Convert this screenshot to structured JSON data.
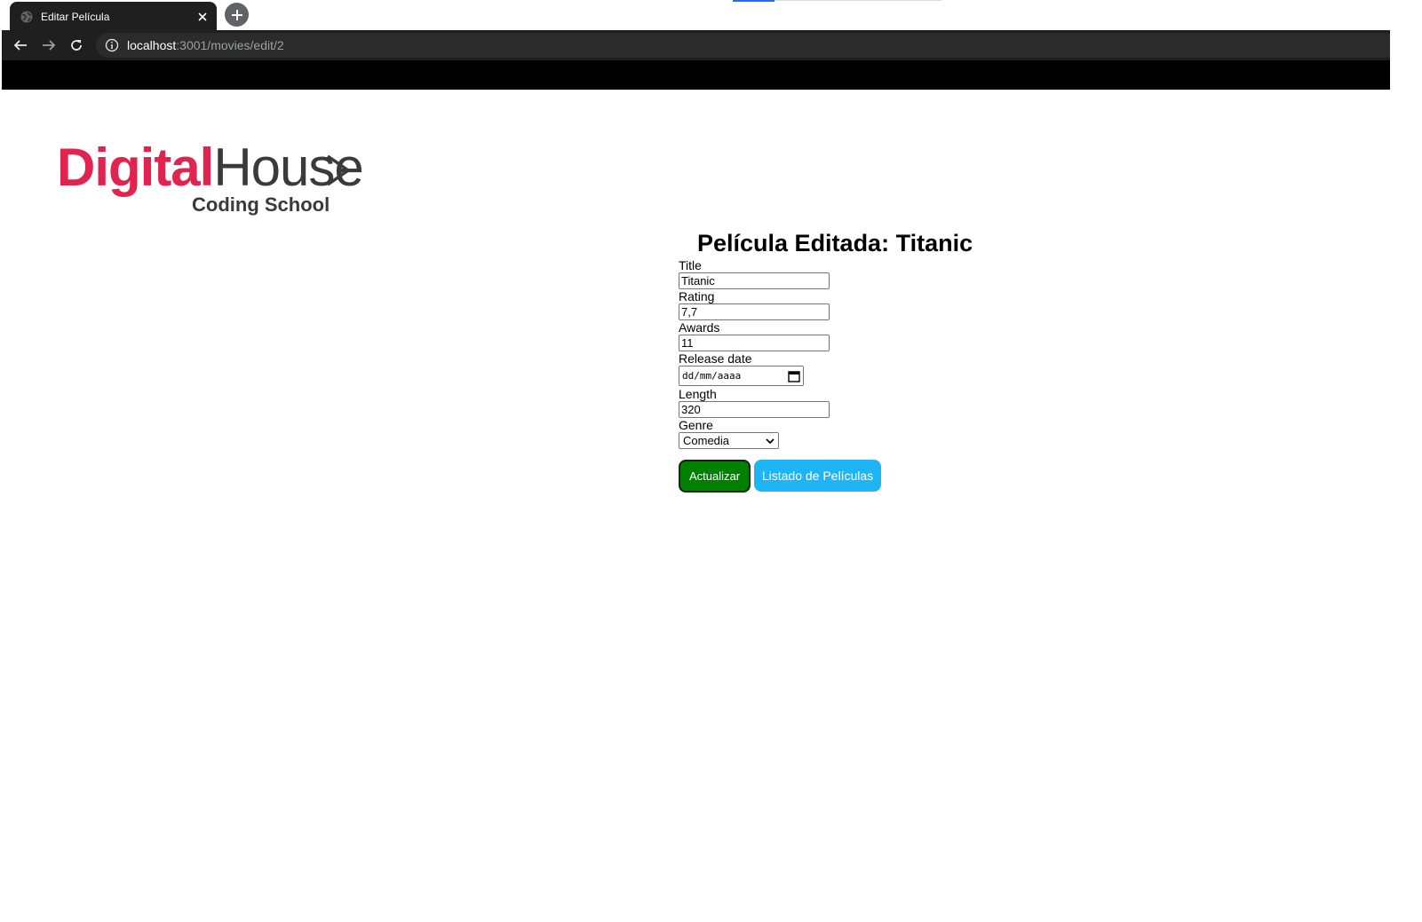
{
  "browser": {
    "tab": {
      "title": "Editar Película",
      "favicon": "globe-icon",
      "close_icon": "close-icon"
    },
    "new_tab_icon": "plus-icon",
    "nav": {
      "back_icon": "back-arrow-icon",
      "forward_icon": "forward-arrow-icon",
      "reload_icon": "reload-icon"
    },
    "address": {
      "host": "localhost",
      "path": ":3001/movies/edit/2",
      "info_icon": "info-icon"
    }
  },
  "logo": {
    "digital": "Digital",
    "house": "House",
    "subtitle": "Coding School",
    "arrow_icon": "chevron-right-icon"
  },
  "page": {
    "title": "Película Editada: Titanic",
    "fields": {
      "title": {
        "label": "Title",
        "value": "Titanic"
      },
      "rating": {
        "label": "Rating",
        "value": "7,7"
      },
      "awards": {
        "label": "Awards",
        "value": "11"
      },
      "release_date": {
        "label": "Release date",
        "placeholder": "dd/mm/aaaa",
        "icon": "calendar-icon"
      },
      "length": {
        "label": "Length",
        "value": "320"
      },
      "genre": {
        "label": "Genre",
        "value": "Comedia",
        "icon": "chevron-down-icon"
      }
    },
    "buttons": {
      "update": "Actualizar",
      "list": "Listado de Películas"
    }
  },
  "colors": {
    "brand_red": "#e1234f",
    "update_button": "#008000",
    "list_button": "#1fb5f5",
    "chrome_dark": "#1f1f1f"
  }
}
